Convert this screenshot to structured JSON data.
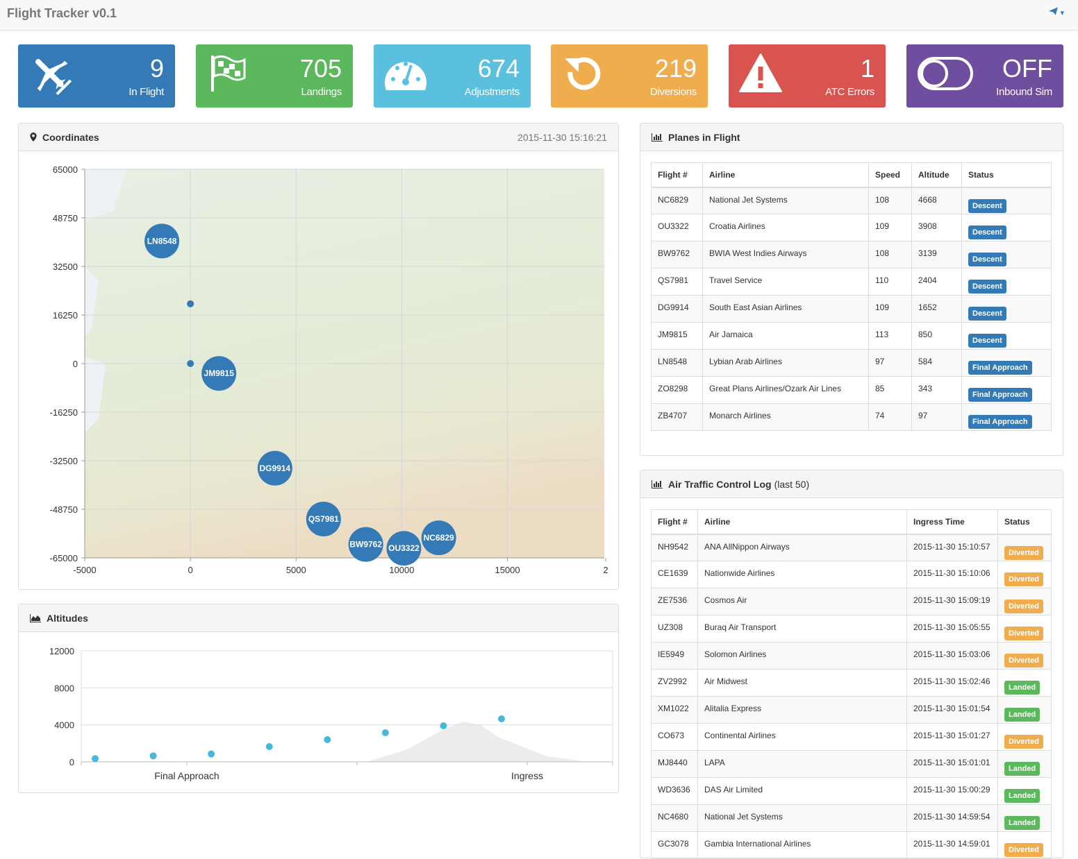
{
  "app": {
    "title": "Flight Tracker v0.1",
    "nav_caret": "▾"
  },
  "stats": [
    {
      "value": "9",
      "label": "In Flight",
      "icon": "plane-icon",
      "color": "#337ab7"
    },
    {
      "value": "705",
      "label": "Landings",
      "icon": "flag-icon",
      "color": "#5cb85c"
    },
    {
      "value": "674",
      "label": "Adjustments",
      "icon": "dashboard-icon",
      "color": "#5bc0de"
    },
    {
      "value": "219",
      "label": "Diversions",
      "icon": "refresh-icon",
      "color": "#f0ad4e"
    },
    {
      "value": "1",
      "label": "ATC Errors",
      "icon": "warning-icon",
      "color": "#d9534f"
    },
    {
      "value": "OFF",
      "label": "Inbound Sim",
      "icon": "toggle-icon",
      "color": "#6f4ea0"
    }
  ],
  "coordinates": {
    "title": "Coordinates",
    "timestamp": "2015-11-30 15:16:21",
    "chart_data": {
      "type": "scatter",
      "title": "",
      "xlabel": "",
      "ylabel": "",
      "xlim": [
        -5000,
        20000
      ],
      "ylim": [
        -65000,
        65000
      ],
      "x_ticks": [
        "-5000",
        "0",
        "5000",
        "10000",
        "15000",
        "2"
      ],
      "y_ticks": [
        "65000",
        "48750",
        "32500",
        "16250",
        "0",
        "-16250",
        "-32500",
        "-48750",
        "-65000"
      ],
      "grid": true,
      "planes": [
        {
          "label": "LN8548",
          "x": -1350,
          "y": 41000
        },
        {
          "label": "JM9815",
          "x": 1350,
          "y": -3300
        },
        {
          "label": "DG9914",
          "x": 4000,
          "y": -35000
        },
        {
          "label": "QS7981",
          "x": 6300,
          "y": -52000
        },
        {
          "label": "BW9762",
          "x": 8300,
          "y": -60500
        },
        {
          "label": "OU3322",
          "x": 10100,
          "y": -61800
        },
        {
          "label": "NC6829",
          "x": 11750,
          "y": -58300
        }
      ],
      "points": [
        {
          "x": 0,
          "y": 20000
        },
        {
          "x": 0,
          "y": 0
        }
      ]
    }
  },
  "altitudes": {
    "title": "Altitudes",
    "chart_data": {
      "type": "scatter",
      "title": "",
      "xlabel": "",
      "ylabel": "",
      "ylim": [
        0,
        12000
      ],
      "y_ticks": [
        "12000",
        "8000",
        "4000",
        "0"
      ],
      "x_labels": [
        "Final Approach",
        "Ingress"
      ],
      "grid": true,
      "x": [
        1,
        2,
        3,
        4,
        5,
        6,
        7,
        8
      ],
      "values": [
        350,
        650,
        850,
        1650,
        2400,
        3150,
        3900,
        4650
      ]
    }
  },
  "planes_table": {
    "title": "Planes in Flight",
    "columns": [
      "Flight #",
      "Airline",
      "Speed",
      "Altitude",
      "Status"
    ],
    "rows": [
      {
        "flight": "NC6829",
        "airline": "National Jet Systems",
        "speed": "108",
        "altitude": "4668",
        "status": "Descent"
      },
      {
        "flight": "OU3322",
        "airline": "Croatia Airlines",
        "speed": "109",
        "altitude": "3908",
        "status": "Descent"
      },
      {
        "flight": "BW9762",
        "airline": "BWIA West Indies Airways",
        "speed": "108",
        "altitude": "3139",
        "status": "Descent"
      },
      {
        "flight": "QS7981",
        "airline": "Travel Service",
        "speed": "110",
        "altitude": "2404",
        "status": "Descent"
      },
      {
        "flight": "DG9914",
        "airline": "South East Asian Airlines",
        "speed": "109",
        "altitude": "1652",
        "status": "Descent"
      },
      {
        "flight": "JM9815",
        "airline": "Air Jamaica",
        "speed": "113",
        "altitude": "850",
        "status": "Descent"
      },
      {
        "flight": "LN8548",
        "airline": "Lybian Arab Airlines",
        "speed": "97",
        "altitude": "584",
        "status": "Final Approach"
      },
      {
        "flight": "ZO8298",
        "airline": "Great Plans Airlines/Ozark Air Lines",
        "speed": "85",
        "altitude": "343",
        "status": "Final Approach"
      },
      {
        "flight": "ZB4707",
        "airline": "Monarch Airlines",
        "speed": "74",
        "altitude": "97",
        "status": "Final Approach"
      }
    ]
  },
  "atc_log": {
    "title": "Air Traffic Control Log",
    "suffix": "(last 50)",
    "columns": [
      "Flight #",
      "Airline",
      "Ingress Time",
      "Status"
    ],
    "rows": [
      {
        "flight": "NH9542",
        "airline": "ANA AllNippon Airways",
        "time": "2015-11-30 15:10:57",
        "status": "Diverted"
      },
      {
        "flight": "CE1639",
        "airline": "Nationwide Airlines",
        "time": "2015-11-30 15:10:06",
        "status": "Diverted"
      },
      {
        "flight": "ZE7536",
        "airline": "Cosmos Air",
        "time": "2015-11-30 15:09:19",
        "status": "Diverted"
      },
      {
        "flight": "UZ308",
        "airline": "Buraq Air Transport",
        "time": "2015-11-30 15:05:55",
        "status": "Diverted"
      },
      {
        "flight": "IE5949",
        "airline": "Solomon Airlines",
        "time": "2015-11-30 15:03:06",
        "status": "Diverted"
      },
      {
        "flight": "ZV2992",
        "airline": "Air Midwest",
        "time": "2015-11-30 15:02:46",
        "status": "Landed"
      },
      {
        "flight": "XM1022",
        "airline": "Alitalia Express",
        "time": "2015-11-30 15:01:54",
        "status": "Landed"
      },
      {
        "flight": "CO673",
        "airline": "Continental Airlines",
        "time": "2015-11-30 15:01:27",
        "status": "Diverted"
      },
      {
        "flight": "MJ8440",
        "airline": "LAPA",
        "time": "2015-11-30 15:01:01",
        "status": "Landed"
      },
      {
        "flight": "WD3636",
        "airline": "DAS Air Limited",
        "time": "2015-11-30 15:00:29",
        "status": "Landed"
      },
      {
        "flight": "NC4680",
        "airline": "National Jet Systems",
        "time": "2015-11-30 14:59:54",
        "status": "Landed"
      },
      {
        "flight": "GC3078",
        "airline": "Gambia International Airlines",
        "time": "2015-11-30 14:59:01",
        "status": "Diverted"
      }
    ]
  },
  "status_colors": {
    "Descent": "#337ab7",
    "Final Approach": "#337ab7",
    "Diverted": "#f0ad4e",
    "Landed": "#5cb85c"
  }
}
